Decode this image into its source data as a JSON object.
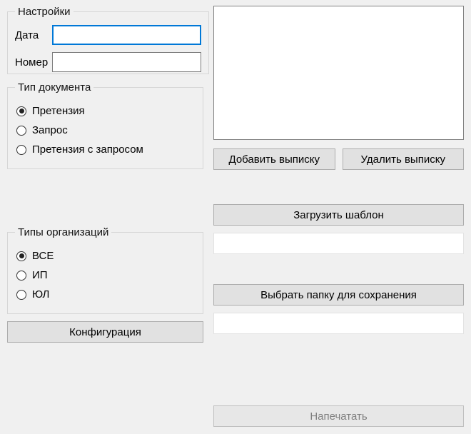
{
  "settings": {
    "legend": "Настройки",
    "date_label": "Дата",
    "date_value": "",
    "number_label": "Номер",
    "number_value": ""
  },
  "doc_type": {
    "legend": "Тип документа",
    "options": [
      {
        "label": "Претензия",
        "checked": true
      },
      {
        "label": "Запрос",
        "checked": false
      },
      {
        "label": "Претензия с запросом",
        "checked": false
      }
    ]
  },
  "org_type": {
    "legend": "Типы организаций",
    "options": [
      {
        "label": "ВСЕ",
        "checked": true
      },
      {
        "label": "ИП",
        "checked": false
      },
      {
        "label": "ЮЛ",
        "checked": false
      }
    ]
  },
  "buttons": {
    "configuration": "Конфигурация",
    "add_statement": "Добавить выписку",
    "delete_statement": "Удалить выписку",
    "load_template": "Загрузить шаблон",
    "choose_folder": "Выбрать папку для сохранения",
    "print": "Напечатать"
  },
  "template_path": "",
  "save_folder_path": ""
}
